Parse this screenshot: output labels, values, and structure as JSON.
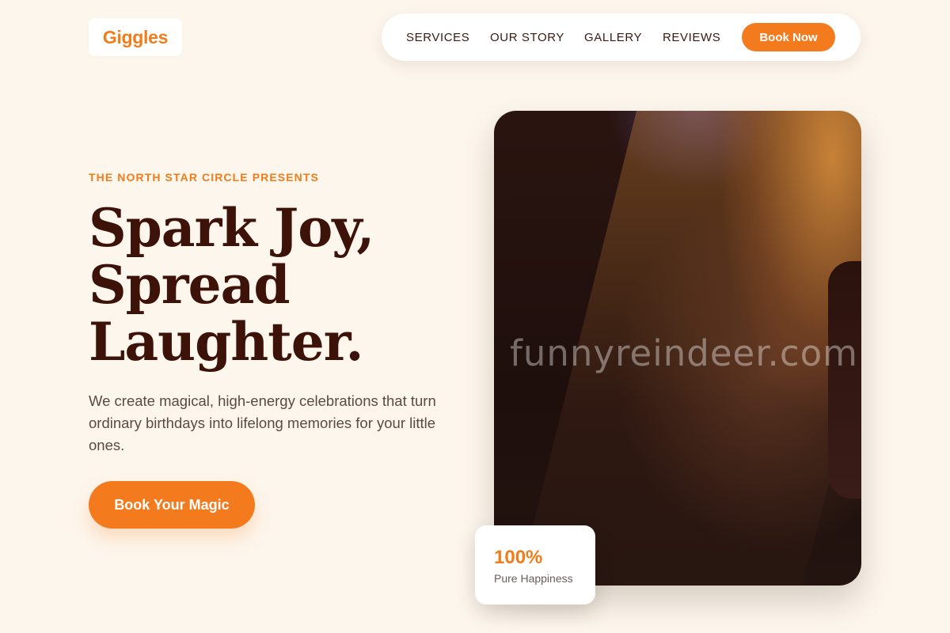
{
  "brand": {
    "logo_text": "Giggles",
    "accent": "#f47a1e",
    "background": "#fdf6ec",
    "headline_color": "#3d1208"
  },
  "nav": {
    "links": [
      "SERVICES",
      "OUR STORY",
      "GALLERY",
      "REVIEWS"
    ],
    "book_label": "Book Now"
  },
  "hero": {
    "eyebrow": "THE NORTH STAR CIRCLE PRESENTS",
    "headline": [
      "Spark Joy,",
      "Spread",
      "Laughter."
    ],
    "subtitle": "We create magical, high-energy celebrations that turn ordinary birthdays into lifelong memories for your little ones.",
    "cta_label": "Book Your Magic",
    "image_alt": "performer on stage under spotlight",
    "watermark": "funnyreindeer.com"
  },
  "stat": {
    "value": "100%",
    "label": "Pure Happiness"
  }
}
